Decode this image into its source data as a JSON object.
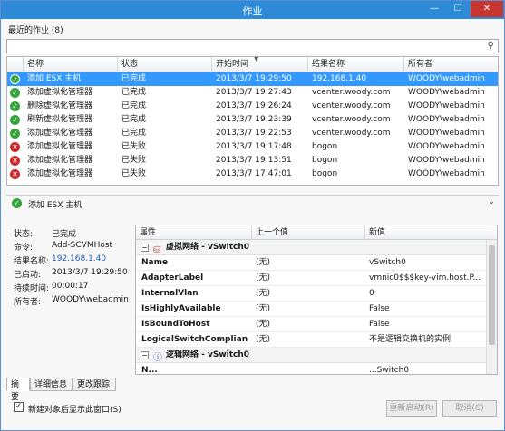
{
  "window": {
    "title": "作业",
    "min": "—",
    "max": "☐",
    "close": "✕"
  },
  "recent": {
    "heading": "最近的作业 (8)"
  },
  "search": {
    "placeholder": "",
    "icon": "search-icon"
  },
  "grid": {
    "headers": [
      "名称",
      "状态",
      "开始时间",
      "结果名称",
      "所有者"
    ],
    "sort_indicator": "▼",
    "rows": [
      {
        "status": "ok",
        "name": "添加 ESX 主机",
        "state": "已完成",
        "start": "2013/3/7 19:29:50",
        "result": "192.168.1.40",
        "owner": "WOODY\\webadmin"
      },
      {
        "status": "ok",
        "name": "添加虚拟化管理器",
        "state": "已完成",
        "start": "2013/3/7 19:27:43",
        "result": "vcenter.woody.com",
        "owner": "WOODY\\webadmin"
      },
      {
        "status": "ok",
        "name": "删除虚拟化管理器",
        "state": "已完成",
        "start": "2013/3/7 19:26:24",
        "result": "vcenter.woody.com",
        "owner": "WOODY\\webadmin"
      },
      {
        "status": "ok",
        "name": "刷新虚拟化管理器",
        "state": "已完成",
        "start": "2013/3/7 19:23:39",
        "result": "vcenter.woody.com",
        "owner": "WOODY\\webadmin"
      },
      {
        "status": "ok",
        "name": "添加虚拟化管理器",
        "state": "已完成",
        "start": "2013/3/7 19:22:53",
        "result": "vcenter.woody.com",
        "owner": "WOODY\\webadmin"
      },
      {
        "status": "fail",
        "name": "添加虚拟化管理器",
        "state": "已失败",
        "start": "2013/3/7 19:17:48",
        "result": "bogon",
        "owner": "WOODY\\webadmin"
      },
      {
        "status": "fail",
        "name": "添加虚拟化管理器",
        "state": "已失败",
        "start": "2013/3/7 19:13:51",
        "result": "bogon",
        "owner": "WOODY\\webadmin"
      },
      {
        "status": "fail",
        "name": "添加虚拟化管理器",
        "state": "已失败",
        "start": "2013/3/7 17:47:01",
        "result": "bogon",
        "owner": "WOODY\\webadmin"
      }
    ]
  },
  "detail": {
    "title": "添加 ESX 主机",
    "chevron": "⌄",
    "fields": [
      {
        "label": "状态:",
        "value": "已完成"
      },
      {
        "label": "命令:",
        "value": "Add-SCVMHost"
      },
      {
        "label": "结果名称:",
        "value": "192.168.1.40"
      },
      {
        "label": "已启动:",
        "value": "2013/3/7 19:29:50"
      },
      {
        "label": "持续时间:",
        "value": "00:00:17"
      },
      {
        "label": "所有者:",
        "value": "WOODY\\webadmin"
      }
    ]
  },
  "props": {
    "headers": [
      "属性",
      "上一个值",
      "新值"
    ],
    "group1": "虚拟网络 - vSwitch0",
    "rows": [
      {
        "name": "Name",
        "prev": "(无)",
        "new": "vSwitch0"
      },
      {
        "name": "AdapterLabel",
        "prev": "(无)",
        "new": "vmnic0$$$key-vim.host.P..."
      },
      {
        "name": "InternalVlan",
        "prev": "(无)",
        "new": "0"
      },
      {
        "name": "IsHighlyAvailable",
        "prev": "(无)",
        "new": "False"
      },
      {
        "name": "IsBoundToHost",
        "prev": "(无)",
        "new": "False"
      },
      {
        "name": "LogicalSwitchComplianc...",
        "prev": "(无)",
        "new": "不是逻辑交换机的实例"
      }
    ],
    "group2": "逻辑网络 - vSwitch0",
    "partial_row": {
      "name": "N...",
      "prev": "",
      "new": "...Switch0"
    }
  },
  "tabs": [
    "摘要",
    "详细信息",
    "更改跟踪"
  ],
  "footer": {
    "checkbox_label": "新建对象后显示此窗口(S)",
    "checked": "✓",
    "restart": "重新启动(R)",
    "cancel": "取消(C)"
  }
}
